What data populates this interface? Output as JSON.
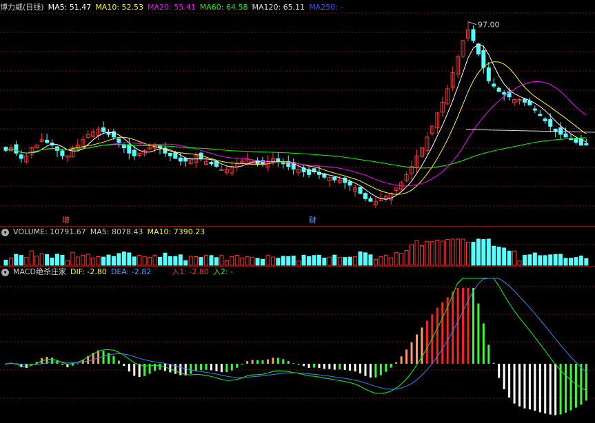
{
  "main": {
    "stock": "博力威(日线)",
    "ma": [
      {
        "label": "MA5: 51.47",
        "color": "#ffffff"
      },
      {
        "label": "MA10: 52.53",
        "color": "#ffff00"
      },
      {
        "label": "MA20: 55.41",
        "color": "#ff00ff"
      },
      {
        "label": "MA60: 64.58",
        "color": "#00ff00"
      },
      {
        "label": "MA120: 65.11",
        "color": "#dddddd"
      },
      {
        "label": "MA250: -",
        "color": "#3355ff"
      }
    ],
    "peak_label": "97.00",
    "marker_zeng": "增",
    "marker_cai": "财"
  },
  "volume": {
    "title": "VOLUME: 10791.67",
    "ma5": "MA5: 8078.43",
    "ma10": "MA10: 7390.23"
  },
  "macd": {
    "title": "MACD绝杀庄家",
    "dif": "DIF: -2.80",
    "dea": "DEA: -2.82",
    "in1": "入1: -2.80",
    "in2": "入2: -"
  },
  "colors": {
    "up": "#ff3232",
    "down": "#54ffff",
    "ma5": "#ffffff",
    "ma10": "#ffff00",
    "ma20": "#ff00ff",
    "ma60": "#00ff00",
    "ma120": "#dddddd",
    "grid": "#8a1010"
  },
  "chart_data": {
    "type": "candlestick",
    "closes": [
      49,
      50,
      48,
      46,
      47,
      50,
      51,
      53,
      52,
      51,
      49,
      47,
      47,
      50,
      51,
      53,
      55,
      56,
      57,
      56,
      55,
      54,
      52,
      50,
      48,
      47,
      48,
      49,
      50,
      51,
      50,
      48,
      47,
      46,
      45,
      45,
      46,
      47,
      46,
      45,
      44,
      43,
      42,
      42,
      43,
      44,
      45,
      46,
      45,
      44,
      44,
      45,
      46,
      45,
      44,
      43,
      42,
      42,
      41,
      40,
      41,
      40,
      39,
      39,
      38,
      38,
      37,
      36,
      35,
      33,
      31,
      30,
      30,
      31,
      32,
      33,
      35,
      37,
      40,
      43,
      47,
      50,
      54,
      58,
      63,
      67,
      72,
      78,
      84,
      90,
      94,
      90,
      85,
      80,
      75,
      73,
      71,
      70,
      69,
      68,
      68,
      67,
      66,
      64,
      62,
      60,
      58,
      56,
      55,
      54,
      53,
      52,
      51,
      51
    ],
    "y_range": [
      28,
      100
    ],
    "peak": 97.0
  }
}
